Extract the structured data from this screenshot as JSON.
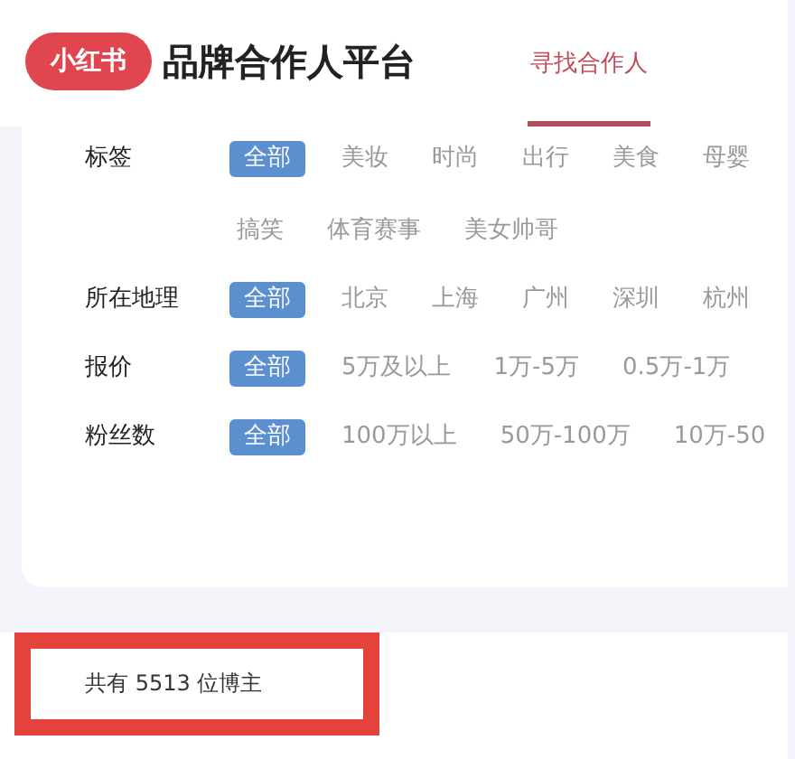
{
  "header": {
    "logo": "小红书",
    "title": "品牌合作人平台",
    "nav": [
      {
        "label": "寻找合作人",
        "selected": true
      }
    ]
  },
  "filters": [
    {
      "label": "标签",
      "options": [
        {
          "label": "全部",
          "selected": true
        },
        {
          "label": "美妆",
          "selected": false
        },
        {
          "label": "时尚",
          "selected": false
        },
        {
          "label": "出行",
          "selected": false
        },
        {
          "label": "美食",
          "selected": false
        },
        {
          "label": "母婴",
          "selected": false
        },
        {
          "label": "搞笑",
          "selected": false
        },
        {
          "label": "体育赛事",
          "selected": false
        },
        {
          "label": "美女帅哥",
          "selected": false
        }
      ]
    },
    {
      "label": "所在地理",
      "options": [
        {
          "label": "全部",
          "selected": true
        },
        {
          "label": "北京",
          "selected": false
        },
        {
          "label": "上海",
          "selected": false
        },
        {
          "label": "广州",
          "selected": false
        },
        {
          "label": "深圳",
          "selected": false
        },
        {
          "label": "杭州",
          "selected": false
        }
      ]
    },
    {
      "label": "报价",
      "options": [
        {
          "label": "全部",
          "selected": true
        },
        {
          "label": "5万及以上",
          "selected": false
        },
        {
          "label": "1万-5万",
          "selected": false
        },
        {
          "label": "0.5万-1万",
          "selected": false
        }
      ]
    },
    {
      "label": "粉丝数",
      "options": [
        {
          "label": "全部",
          "selected": true
        },
        {
          "label": "100万以上",
          "selected": false
        },
        {
          "label": "50万-100万",
          "selected": false
        },
        {
          "label": "10万-50",
          "selected": false
        }
      ]
    }
  ],
  "summary": {
    "text": "共有 5513 位博主",
    "highlighted": true
  }
}
